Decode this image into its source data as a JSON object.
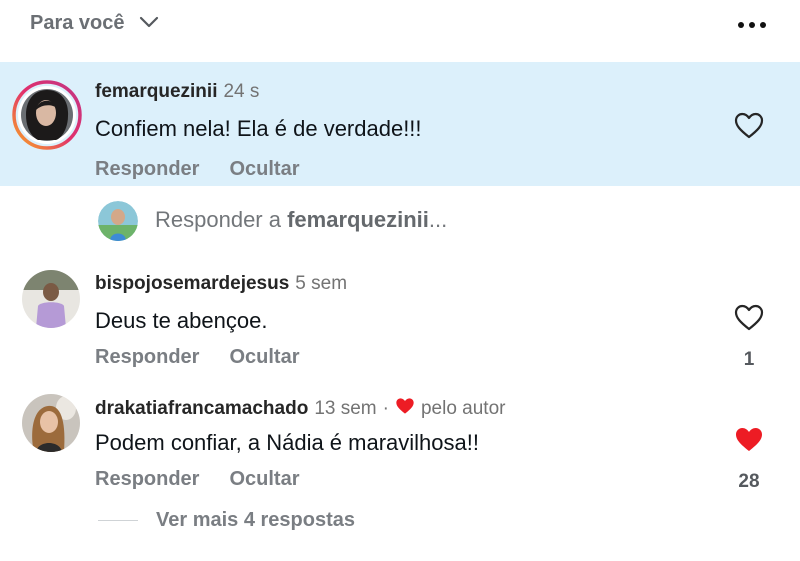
{
  "header": {
    "filter_label": "Para você",
    "chevron_icon": "chevron-down-icon",
    "more_icon": "more-horizontal-icon"
  },
  "comments": [
    {
      "username": "femarquezinii",
      "time": "24 s",
      "text": "Confiem nela! Ela é de verdade!!!",
      "reply_label": "Responder",
      "hide_label": "Ocultar",
      "liked": false,
      "like_count": null
    },
    {
      "username": "bispojosemardejesus",
      "time": "5 sem",
      "text": "Deus te abençoe.",
      "reply_label": "Responder",
      "hide_label": "Ocultar",
      "liked": false,
      "like_count": "1"
    },
    {
      "username": "drakatiafrancamachado",
      "time": "13 sem",
      "separator": "·",
      "author_badge": "pelo autor",
      "text": "Podem confiar, a Nádia é maravilhosa!!",
      "reply_label": "Responder",
      "hide_label": "Ocultar",
      "liked": true,
      "like_count": "28"
    }
  ],
  "reply_bar": {
    "prefix": "Responder a ",
    "target": "femarquezinii",
    "suffix": "..."
  },
  "more_replies_label": "Ver mais 4 respostas",
  "colors": {
    "highlight": "#dcf0fb",
    "like_red": "#ed1c24",
    "story_ring_start": "#f9a825",
    "story_ring_end": "#d6249f"
  }
}
